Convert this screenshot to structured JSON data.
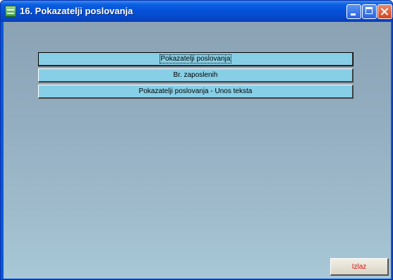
{
  "window": {
    "title": "16. Pokazatelji poslovanja",
    "icon": "form-icon"
  },
  "titlebar_buttons": [
    "minimize",
    "maximize",
    "close"
  ],
  "menu": {
    "items": [
      {
        "label": "Pokazatelji poslovanja",
        "focused": true
      },
      {
        "label": "Br. zaposlenih",
        "focused": false
      },
      {
        "label": "Pokazatelji poslovanja - Unos teksta",
        "focused": false
      }
    ]
  },
  "footer": {
    "exit_label": "Izlaz",
    "exit_color": "#e01010"
  },
  "colors": {
    "titlebar": "#0550d8",
    "menu_button": "#87cfe6"
  }
}
